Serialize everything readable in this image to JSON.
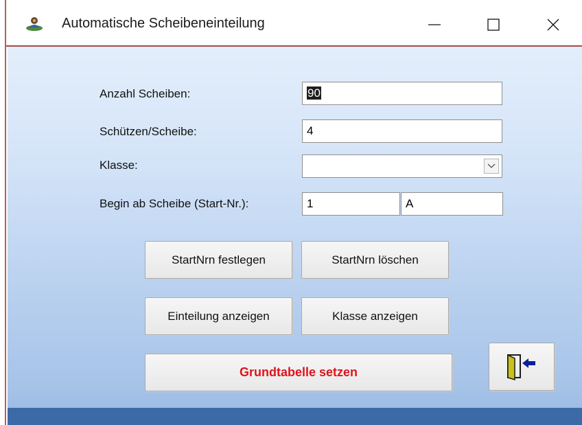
{
  "window": {
    "title": "Automatische Scheibeneinteilung",
    "min_glyph": "—",
    "max_glyph": "☐",
    "close_glyph": "✕"
  },
  "form": {
    "anzahl_label": "Anzahl Scheiben:",
    "anzahl_value": "90",
    "schuetzen_label": "Schützen/Scheibe:",
    "schuetzen_value": "4",
    "klasse_label": "Klasse:",
    "klasse_value": "",
    "begin_label": "Begin ab Scheibe (Start-Nr.):",
    "begin_number": "1",
    "begin_letter": "A"
  },
  "buttons": {
    "festlegen": "StartNrn festlegen",
    "loeschen": "StartNrn löschen",
    "einteilung": "Einteilung anzeigen",
    "klasse_anzeigen": "Klasse anzeigen",
    "grundtabelle": "Grundtabelle setzen"
  },
  "colors": {
    "accent_red": "#e0141b",
    "title_border": "#a44a47",
    "bottom_band": "#3b6aa7"
  },
  "icons": {
    "app": "target-shooter-icon",
    "exit": "exit-door-icon",
    "combo": "chevron-down-icon"
  }
}
